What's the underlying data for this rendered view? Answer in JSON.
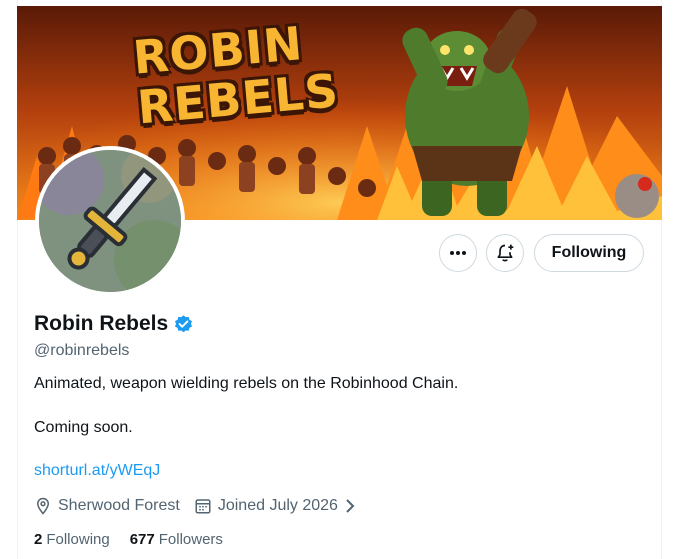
{
  "profile": {
    "banner_title_line1": "ROBIN",
    "banner_title_line2": "REBELS",
    "display_name": "Robin Rebels",
    "handle": "@robinrebels",
    "bio_line1": "Animated, weapon wielding rebels on the Robinhood Chain.",
    "bio_line2": "Coming soon.",
    "link": "shorturl.at/yWEqJ",
    "location": "Sherwood Forest",
    "joined": "Joined July 2026",
    "following_count": "2",
    "following_label": "Following",
    "followers_count": "677",
    "followers_label": "Followers",
    "verified": true
  },
  "actions": {
    "more_icon": "more-dots-icon",
    "notify_icon": "bell-plus-icon",
    "following_button": "Following"
  },
  "icons": {
    "location": "location-pin-icon",
    "calendar": "calendar-icon",
    "chevron": "chevron-right-icon",
    "verified": "verified-badge-icon"
  },
  "colors": {
    "accent": "#1d9bf0",
    "text": "#0f1419",
    "muted": "#536471",
    "border": "#cfd9de"
  }
}
